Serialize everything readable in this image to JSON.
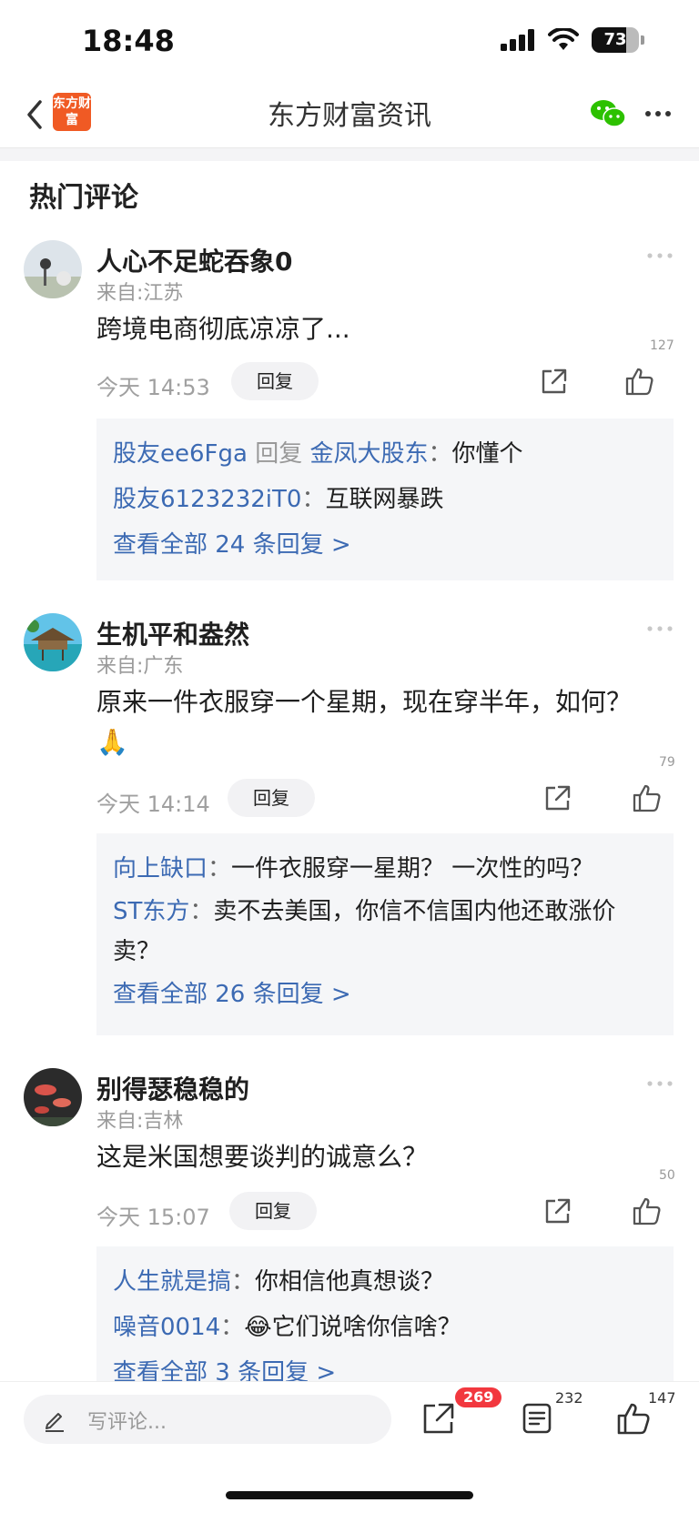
{
  "status": {
    "time": "18:48",
    "battery": "73",
    "battery_level": 0.73
  },
  "nav": {
    "logo": "东方财富",
    "title": "东方财富资讯"
  },
  "section_title": "热门评论",
  "comments": [
    {
      "username": "人心不足蛇吞象0",
      "location": "来自:江苏",
      "text": "跨境电商彻底凉凉了...",
      "time": "今天 14:53",
      "reply_label": "回复",
      "likes": "127",
      "replies": [
        {
          "user": "股友ee6Fga",
          "verb": "回复",
          "target": "金凤大股东",
          "text": "你懂个"
        },
        {
          "user": "股友6123232iT0",
          "text": "互联网暴跌"
        }
      ],
      "view_all": "查看全部 24 条回复 >"
    },
    {
      "username": "生机平和盎然",
      "location": "来自:广东",
      "text": "原来一件衣服穿一个星期，现在穿半年，如何？ 🙏",
      "time": "今天 14:14",
      "reply_label": "回复",
      "likes": "79",
      "replies": [
        {
          "user": "向上缺口",
          "text": "一件衣服穿一星期？ 一次性的吗？"
        },
        {
          "user": "ST东方",
          "text": "卖不去美国，你信不信国内他还敢涨价卖？"
        }
      ],
      "view_all": "查看全部 26 条回复 >"
    },
    {
      "username": "别得瑟稳稳的",
      "location": "来自:吉林",
      "text": "这是米国想要谈判的诚意么？",
      "time": "今天 15:07",
      "reply_label": "回复",
      "likes": "50",
      "replies": [
        {
          "user": "人生就是搞",
          "text": "你相信他真想谈？"
        },
        {
          "user": "噪音0014",
          "text": "😂它们说啥你信啥？"
        }
      ],
      "view_all": "查看全部 3 条回复 >"
    }
  ],
  "bottom": {
    "placeholder": "写评论...",
    "share_count": "269",
    "comment_count": "232",
    "like_count": "147"
  },
  "colors": {
    "accent_blue": "#3c6ab3",
    "badge_red": "#f2383f",
    "logo_orange": "#f05a24",
    "wechat_green": "#2dc100"
  }
}
